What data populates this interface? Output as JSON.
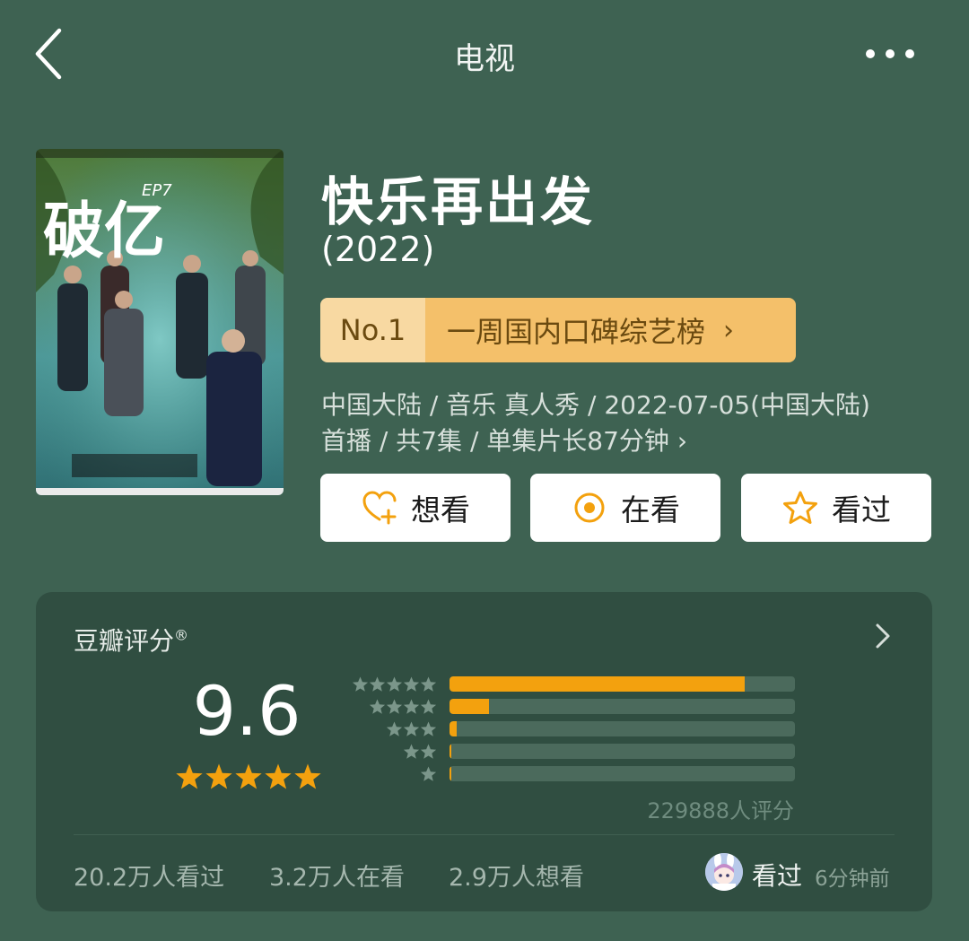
{
  "header": {
    "title": "电视",
    "back_icon": "back-chevron-icon",
    "more_icon": "more-dots-icon"
  },
  "show": {
    "title": "快乐再出发",
    "year": "(2022)",
    "poster": {
      "title_art": "破亿",
      "episode_tag": "EP7"
    },
    "rank": {
      "number": "No.1",
      "label": "一周国内口碑综艺榜",
      "arrow": "›"
    },
    "meta_line1": "中国大陆 / 音乐 真人秀 / 2022-07-05(中国大陆)",
    "meta_line2": "首播 / 共7集 / 单集片长87分钟 ›"
  },
  "actions": [
    {
      "label": "想看",
      "icon": "heart-plus-icon"
    },
    {
      "label": "在看",
      "icon": "circle-dot-icon"
    },
    {
      "label": "看过",
      "icon": "star-outline-icon"
    }
  ],
  "rating": {
    "title": "豆瓣评分",
    "registered_mark": "®",
    "score": "9.6",
    "score_stars": 5,
    "distribution": [
      {
        "stars": 5,
        "fraction": 0.855
      },
      {
        "stars": 4,
        "fraction": 0.115
      },
      {
        "stars": 3,
        "fraction": 0.02
      },
      {
        "stars": 2,
        "fraction": 0.003
      },
      {
        "stars": 1,
        "fraction": 0.003
      }
    ],
    "count_text": "229888人评分",
    "stats": [
      "20.2万人看过",
      "3.2万人在看",
      "2.9万人想看"
    ],
    "friend": {
      "action": "看过",
      "time": "6分钟前"
    }
  },
  "colors": {
    "background": "#3e6252",
    "card": "#304e41",
    "accent_orange": "#f3a10e",
    "rank_light": "#f8d9a2",
    "rank_dark": "#f4c06a"
  }
}
